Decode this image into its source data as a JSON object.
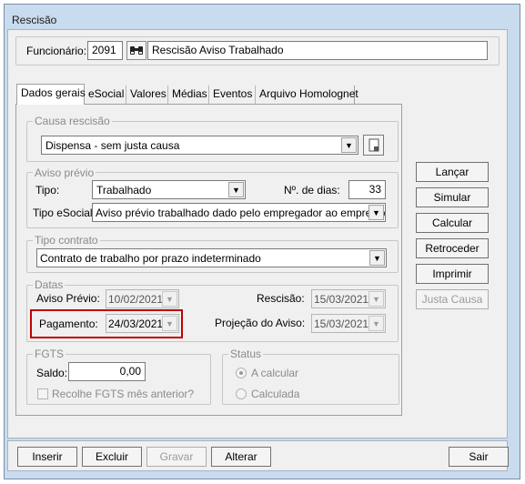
{
  "window": {
    "title": "Rescisão"
  },
  "header": {
    "funcionario_label": "Funcionário:",
    "funcionario_code": "2091",
    "funcionario_name": "Rescisão Aviso Trabalhado"
  },
  "tabs": [
    {
      "label": "Dados gerais"
    },
    {
      "label": "eSocial"
    },
    {
      "label": "Valores"
    },
    {
      "label": "Médias"
    },
    {
      "label": "Eventos"
    },
    {
      "label": "Arquivo Homolognet"
    }
  ],
  "causa": {
    "group_label": "Causa rescisão",
    "value": "Dispensa - sem justa causa"
  },
  "aviso": {
    "group_label": "Aviso prévio",
    "tipo_label": "Tipo:",
    "tipo_value": "Trabalhado",
    "dias_label": "Nº. de dias:",
    "dias_value": "33",
    "tipo_esocial_label": "Tipo eSocial:",
    "tipo_esocial_value": "Aviso prévio trabalhado dado pelo empregador ao empregado,"
  },
  "contrato": {
    "group_label": "Tipo contrato",
    "value": "Contrato de trabalho por prazo indeterminado"
  },
  "datas": {
    "group_label": "Datas",
    "aviso_previo_label": "Aviso Prévio:",
    "aviso_previo_value": "10/02/2021",
    "rescisao_label": "Rescisão:",
    "rescisao_value": "15/03/2021",
    "pagamento_label": "Pagamento:",
    "pagamento_value": "24/03/2021",
    "projecao_label": "Projeção do Aviso:",
    "projecao_value": "15/03/2021"
  },
  "fgts": {
    "group_label": "FGTS",
    "saldo_label": "Saldo:",
    "saldo_value": "0,00",
    "recolhe_label": "Recolhe FGTS mês anterior?"
  },
  "status": {
    "group_label": "Status",
    "option_a": "A calcular",
    "option_b": "Calculada"
  },
  "side_buttons": {
    "lancar": "Lançar",
    "simular": "Simular",
    "calcular": "Calcular",
    "retroceder": "Retroceder",
    "imprimir": "Imprimir",
    "justa_causa": "Justa Causa"
  },
  "bottom_buttons": {
    "inserir": "Inserir",
    "excluir": "Excluir",
    "gravar": "Gravar",
    "alterar": "Alterar",
    "sair": "Sair"
  },
  "colors": {
    "window_frame": "#c9dbee",
    "highlight": "#c00000"
  }
}
